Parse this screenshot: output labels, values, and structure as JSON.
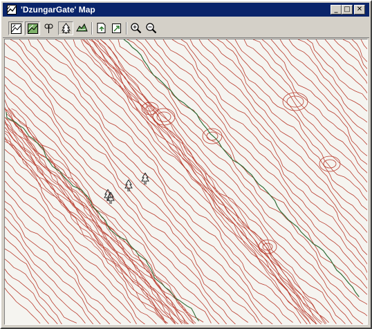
{
  "window": {
    "title": "'DzungarGate' Map",
    "controls": {
      "minimize": "_",
      "maximize": "□",
      "close": "✕"
    }
  },
  "toolbar": {
    "tools": [
      {
        "name": "map-overview-tool",
        "icon": "map-frame-icon",
        "pressed": true
      },
      {
        "name": "map-shaded-tool",
        "icon": "map-shaded-icon",
        "pressed": true
      },
      {
        "name": "flag-tool",
        "icon": "flag-icon",
        "pressed": false
      },
      {
        "name": "tree-tool",
        "icon": "tree-icon",
        "pressed": true
      },
      {
        "name": "terrain-tool",
        "icon": "terrain-icon",
        "pressed": false
      },
      {
        "name": "export-page-tool",
        "icon": "page-export-icon",
        "pressed": false
      },
      {
        "name": "import-page-tool",
        "icon": "page-import-icon",
        "pressed": false
      },
      {
        "name": "zoom-in-tool",
        "icon": "zoom-in-icon",
        "pressed": false
      },
      {
        "name": "zoom-out-tool",
        "icon": "zoom-out-icon",
        "pressed": false
      }
    ]
  },
  "map": {
    "contour_color": "#b83a2c",
    "river_color": "#2f6b35",
    "background": "#f5f4f0",
    "tree_icon": "tree-marker-icon"
  }
}
